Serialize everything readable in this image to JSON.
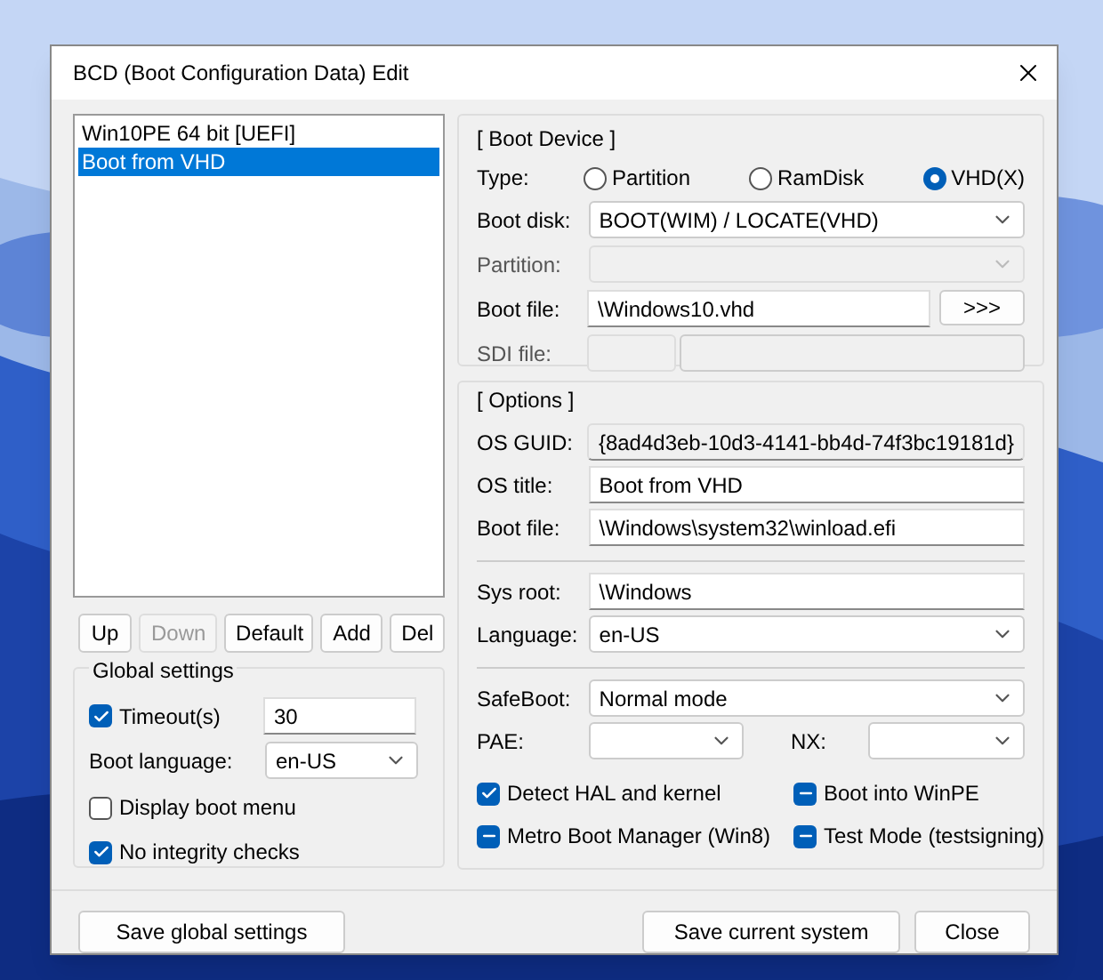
{
  "window": {
    "title": "BCD (Boot Configuration Data) Edit"
  },
  "entries": [
    {
      "label": "Win10PE 64 bit [UEFI]",
      "selected": false
    },
    {
      "label": "Boot from VHD",
      "selected": true
    }
  ],
  "list_buttons": [
    {
      "label": "Up",
      "disabled": false
    },
    {
      "label": "Down",
      "disabled": true
    },
    {
      "label": "Default",
      "disabled": false
    },
    {
      "label": "Add",
      "disabled": false
    },
    {
      "label": "Del",
      "disabled": false
    }
  ],
  "global_settings": {
    "title": "Global settings",
    "timeout": {
      "label": "Timeout(s)",
      "checked": true,
      "value": "30"
    },
    "boot_language": {
      "label": "Boot language:",
      "value": "en-US"
    },
    "options": [
      {
        "label": "Display boot menu",
        "checked": false
      },
      {
        "label": "No integrity checks",
        "checked": true
      }
    ]
  },
  "boot_device": {
    "title": "[ Boot Device ]",
    "type_label": "Type:",
    "types": [
      {
        "label": "Partition",
        "selected": false
      },
      {
        "label": "RamDisk",
        "selected": false
      },
      {
        "label": "VHD(X)",
        "selected": true
      }
    ],
    "rows": [
      {
        "kind": "select",
        "label": "Boot disk:",
        "value": "BOOT(WIM) / LOCATE(VHD)",
        "disabled": false
      },
      {
        "kind": "select",
        "label": "Partition:",
        "disabled": true
      },
      {
        "kind": "file",
        "label": "Boot file:",
        "value": "\\Windows10.vhd",
        "button": ">>>"
      },
      {
        "kind": "sdi",
        "label": "SDI file:"
      }
    ]
  },
  "options": {
    "title": "[ Options ]",
    "groups": [
      [
        {
          "kind": "readonly",
          "label": "OS GUID:",
          "value": "{8ad4d3eb-10d3-4141-bb4d-74f3bc19181d}"
        },
        {
          "kind": "input",
          "label": "OS title:",
          "value": "Boot from VHD"
        },
        {
          "kind": "input",
          "label": "Boot file:",
          "value": "\\Windows\\system32\\winload.efi"
        }
      ],
      [
        {
          "kind": "input",
          "label": "Sys root:",
          "value": "\\Windows"
        },
        {
          "kind": "select",
          "label": "Language:",
          "value": "en-US"
        }
      ],
      [
        {
          "kind": "select",
          "label": "SafeBoot:",
          "value": "Normal mode"
        }
      ]
    ],
    "pae": {
      "label": "PAE:"
    },
    "nx": {
      "label": "NX:"
    },
    "checks": [
      {
        "kind": "checked",
        "label": "Detect HAL and kernel"
      },
      {
        "kind": "indeterminate",
        "label": "Boot into WinPE"
      },
      {
        "kind": "indeterminate",
        "label": "Metro Boot Manager (Win8)"
      },
      {
        "kind": "indeterminate",
        "label": "Test Mode (testsigning)"
      }
    ]
  },
  "footer": [
    {
      "label": "Save global settings"
    },
    {
      "label": "Save current system"
    },
    {
      "label": "Close"
    }
  ]
}
